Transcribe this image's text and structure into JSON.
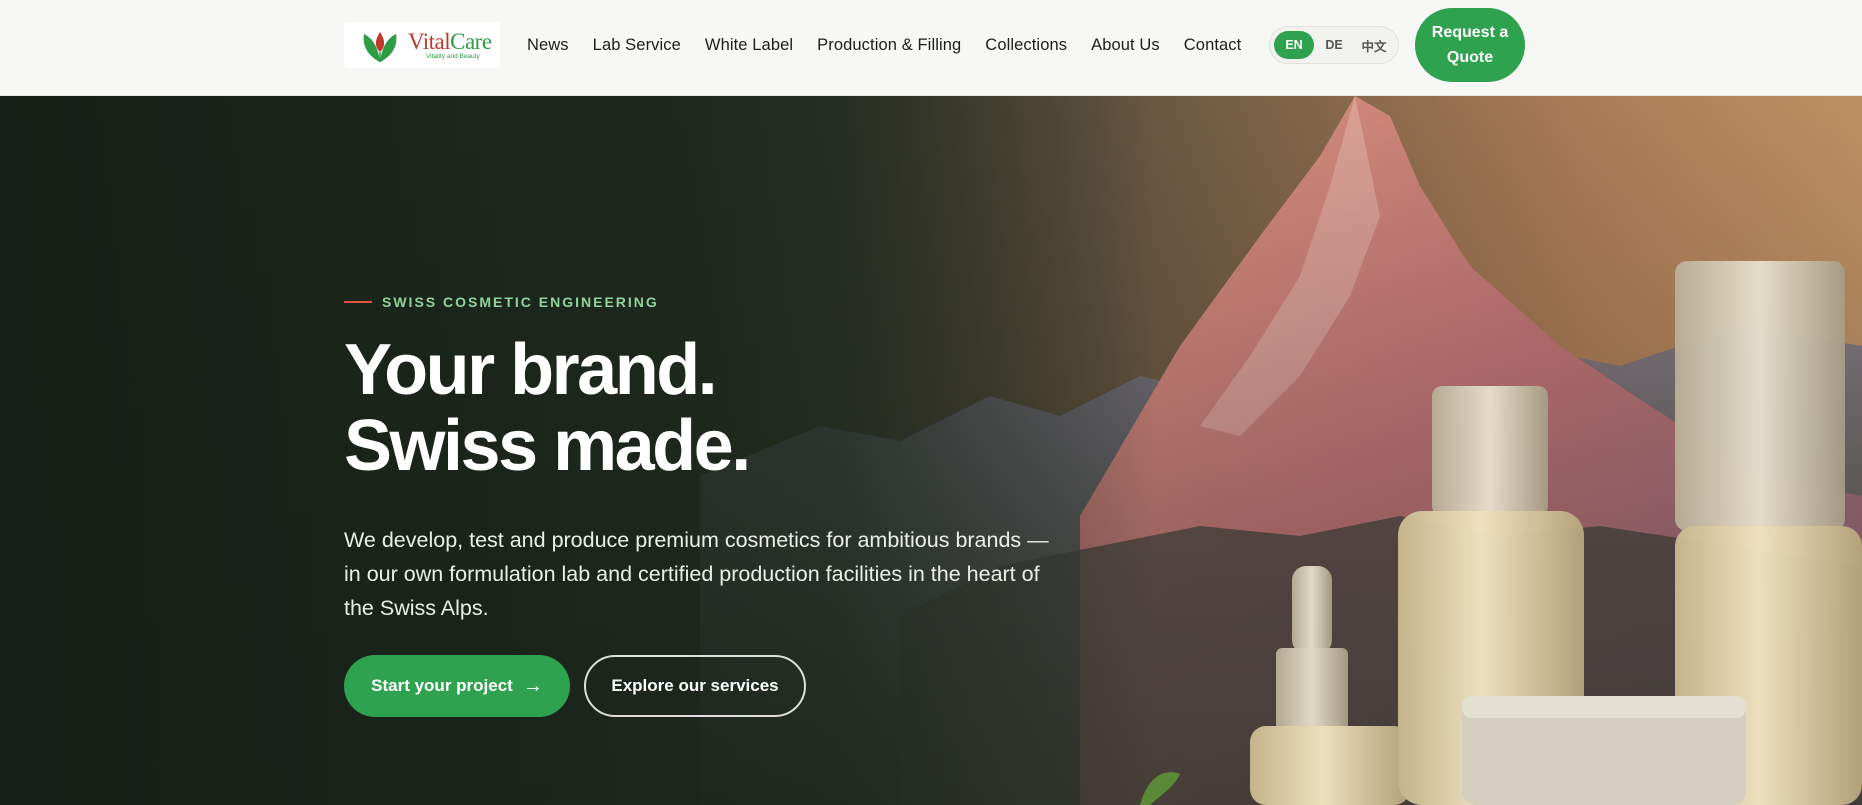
{
  "brand": {
    "logo_name_part1": "Vital",
    "logo_name_part2": "Care",
    "logo_tagline": "Vitality and Beauty",
    "colors": {
      "green": "#2ea24e",
      "red": "#c2392b"
    }
  },
  "nav": {
    "items": [
      {
        "label": "News"
      },
      {
        "label": "Lab Service"
      },
      {
        "label": "White Label"
      },
      {
        "label": "Production & Filling"
      },
      {
        "label": "Collections"
      },
      {
        "label": "About Us"
      },
      {
        "label": "Contact"
      }
    ]
  },
  "language": {
    "options": [
      "EN",
      "DE",
      "中文"
    ],
    "selected": "EN"
  },
  "header": {
    "quote_button": "Request a Quote"
  },
  "hero": {
    "eyebrow": "SWISS COSMETIC ENGINEERING",
    "headline_line1": "Your brand.",
    "headline_line2": "Swiss made.",
    "lead": "We develop, test and produce premium cosmetics for ambitious brands — in our own formulation lab and certified production facilities in the heart of the Swiss Alps.",
    "cta_primary": "Start your project",
    "cta_primary_icon": "arrow-right-icon",
    "cta_secondary": "Explore our services",
    "accent_color": "#e0533f"
  }
}
